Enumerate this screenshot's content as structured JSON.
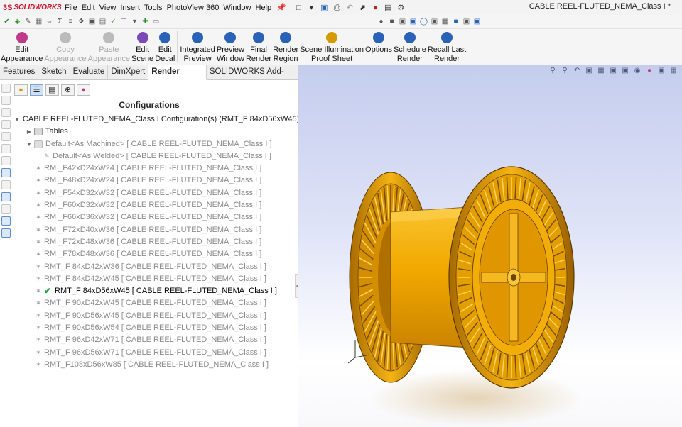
{
  "app": {
    "logo_ds": "3S",
    "logo_name": "SOLIDWORKS",
    "window_title": "CABLE REEL-FLUTED_NEMA_Class I *"
  },
  "menu": [
    "File",
    "Edit",
    "View",
    "Insert",
    "Tools",
    "PhotoView 360",
    "Window",
    "Help"
  ],
  "ribbon": [
    {
      "label": "Edit\nAppearance",
      "icon": "edit-appearance-icon",
      "enabled": true
    },
    {
      "label": "Copy\nAppearance",
      "icon": "copy-appearance-icon",
      "enabled": false
    },
    {
      "label": "Paste\nAppearance",
      "icon": "paste-appearance-icon",
      "enabled": false
    },
    {
      "label": "Edit\nScene",
      "icon": "edit-scene-icon",
      "enabled": true
    },
    {
      "label": "Edit\nDecal",
      "icon": "edit-decal-icon",
      "enabled": true
    },
    {
      "label": "Integrated\nPreview",
      "icon": "integrated-preview-icon",
      "enabled": true
    },
    {
      "label": "Preview\nWindow",
      "icon": "preview-window-icon",
      "enabled": true
    },
    {
      "label": "Final\nRender",
      "icon": "final-render-icon",
      "enabled": true
    },
    {
      "label": "Render\nRegion",
      "icon": "render-region-icon",
      "enabled": true
    },
    {
      "label": "Scene Illumination\nProof Sheet",
      "icon": "scene-illumination-icon",
      "enabled": true
    },
    {
      "label": "Options",
      "icon": "options-icon",
      "enabled": true
    },
    {
      "label": "Schedule\nRender",
      "icon": "schedule-render-icon",
      "enabled": true
    },
    {
      "label": "Recall Last\nRender",
      "icon": "recall-last-render-icon",
      "enabled": true
    }
  ],
  "tabs": [
    {
      "label": "Features",
      "active": false
    },
    {
      "label": "Sketch",
      "active": false
    },
    {
      "label": "Evaluate",
      "active": false
    },
    {
      "label": "DimXpert",
      "active": false
    },
    {
      "label": "Render Tools",
      "active": true
    },
    {
      "label": "SOLIDWORKS Add-Ins",
      "active": false
    }
  ],
  "panel": {
    "heading": "Configurations",
    "root": "CABLE REEL-FLUTED_NEMA_Class I Configuration(s)  (RMT_F 84xD56xW45)",
    "tables": "Tables",
    "default_machined": "Default<As Machined> [ CABLE REEL-FLUTED_NEMA_Class I ]",
    "default_welded": "Default<As Welded> [ CABLE REEL-FLUTED_NEMA_Class I ]",
    "configs": [
      {
        "label": "RM _F42xD24xW24 [ CABLE REEL-FLUTED_NEMA_Class I ]",
        "active": false
      },
      {
        "label": "RM _F48xD24xW24 [ CABLE REEL-FLUTED_NEMA_Class I ]",
        "active": false
      },
      {
        "label": "RM _F54xD32xW32 [ CABLE REEL-FLUTED_NEMA_Class I ]",
        "active": false
      },
      {
        "label": "RM _F60xD32xW32 [ CABLE REEL-FLUTED_NEMA_Class I ]",
        "active": false
      },
      {
        "label": "RM _F66xD36xW32 [ CABLE REEL-FLUTED_NEMA_Class I ]",
        "active": false
      },
      {
        "label": "RM _F72xD40xW36 [ CABLE REEL-FLUTED_NEMA_Class I ]",
        "active": false
      },
      {
        "label": "RM _F72xD48xW36 [ CABLE REEL-FLUTED_NEMA_Class I ]",
        "active": false
      },
      {
        "label": "RM _F78xD48xW36 [ CABLE REEL-FLUTED_NEMA_Class I ]",
        "active": false
      },
      {
        "label": "RMT_F 84xD42xW36 [ CABLE REEL-FLUTED_NEMA_Class I ]",
        "active": false
      },
      {
        "label": "RMT_F 84xD42xW45 [ CABLE REEL-FLUTED_NEMA_Class I ]",
        "active": false
      },
      {
        "label": "RMT_F 84xD56xW45 [ CABLE REEL-FLUTED_NEMA_Class I ]",
        "active": true
      },
      {
        "label": "RMT_F 90xD42xW45 [ CABLE REEL-FLUTED_NEMA_Class I ]",
        "active": false
      },
      {
        "label": "RMT_F 90xD56xW45 [ CABLE REEL-FLUTED_NEMA_Class I ]",
        "active": false
      },
      {
        "label": "RMT_F 90xD56xW54 [ CABLE REEL-FLUTED_NEMA_Class I ]",
        "active": false
      },
      {
        "label": "RMT_F 96xD42xW71 [ CABLE REEL-FLUTED_NEMA_Class I ]",
        "active": false
      },
      {
        "label": "RMT_F 96xD56xW71 [ CABLE REEL-FLUTED_NEMA_Class I ]",
        "active": false
      },
      {
        "label": "RMT_F108xD56xW85 [ CABLE REEL-FLUTED_NEMA_Class I ]",
        "active": false
      }
    ]
  },
  "colors": {
    "model_gold": "#f2a800",
    "model_dark": "#8a5a00",
    "viewport_top": "#c5cdee",
    "active_check": "#1aa23a",
    "brand_red": "#c8102e"
  }
}
